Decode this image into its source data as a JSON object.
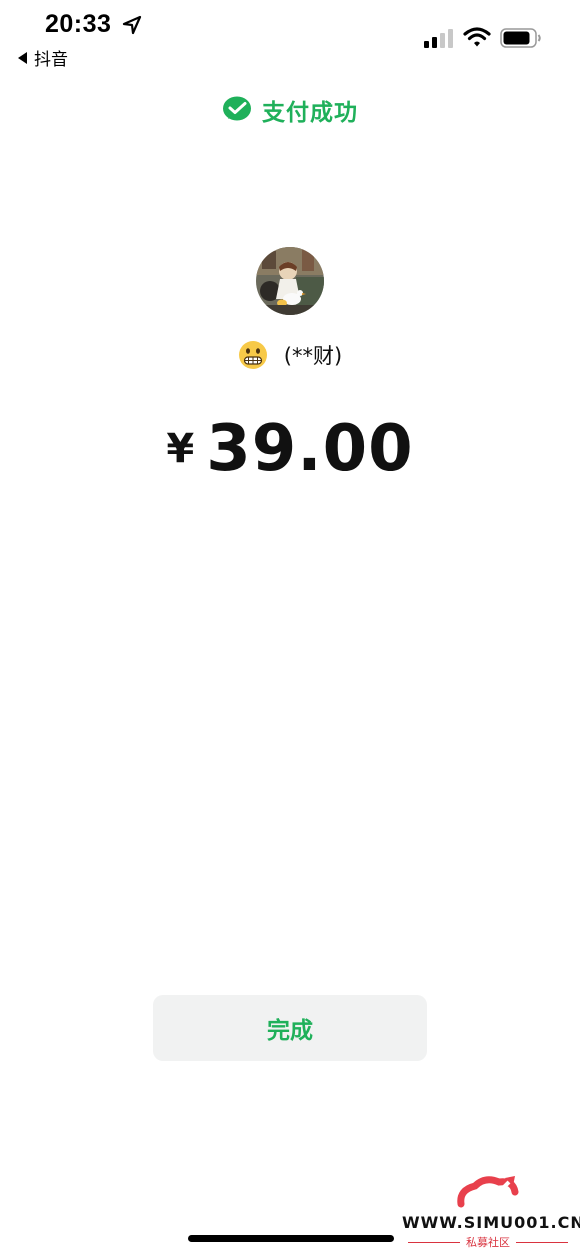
{
  "status_bar": {
    "time": "20:33",
    "back_app": "抖音",
    "location_icon": "location-arrow-icon",
    "signal_icon": "cellular-signal-icon",
    "wifi_icon": "wifi-icon",
    "battery_icon": "battery-icon"
  },
  "header": {
    "icon": "wechat-pay-check-icon",
    "title": "支付成功"
  },
  "payee": {
    "avatar": "avatar",
    "emoji_icon": "grimacing-face-emoji-icon",
    "name": "(**财)"
  },
  "amount": {
    "currency": "¥",
    "value": "39.00"
  },
  "actions": {
    "done_label": "完成"
  },
  "watermark": {
    "url": "WWW.SIMU001.CN",
    "subtitle": "私募社区"
  },
  "colors": {
    "accent": "#1fb05a",
    "button_bg": "#f1f2f2",
    "text": "#111111"
  }
}
